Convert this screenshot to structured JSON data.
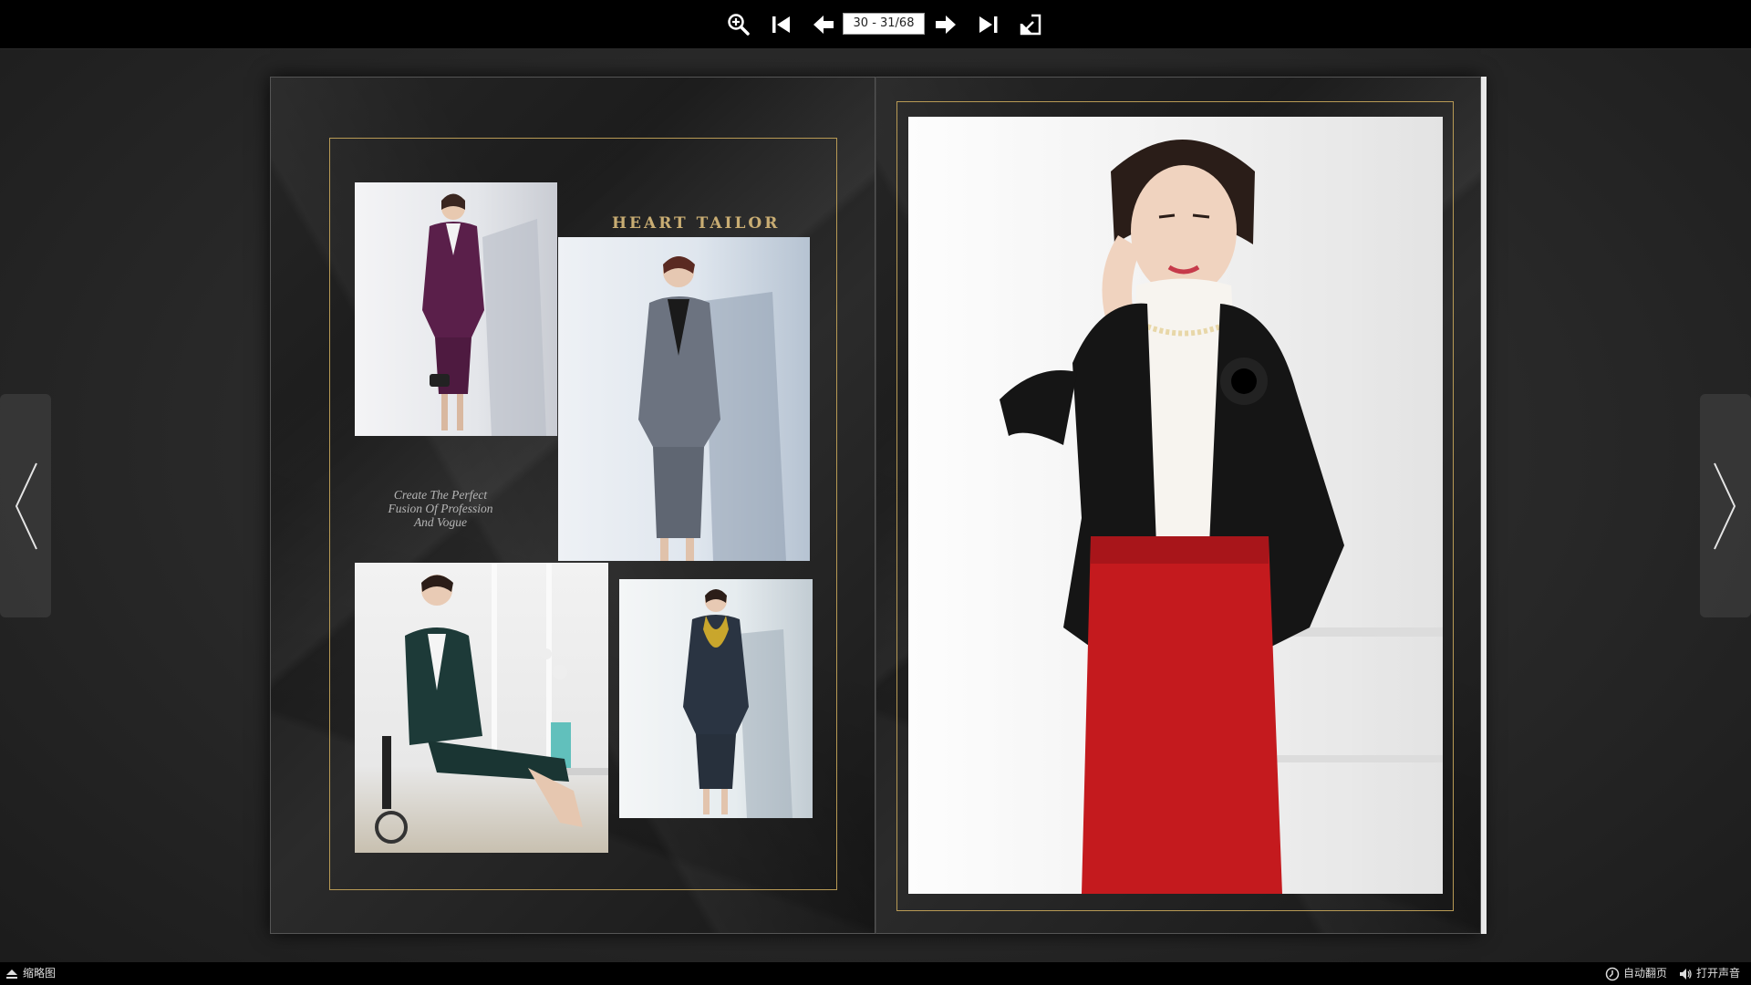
{
  "toolbar": {
    "page_indicator": "30 - 31/68",
    "icons": [
      "zoom-in-icon",
      "first-page-icon",
      "prev-page-icon",
      "next-page-icon",
      "last-page-icon",
      "share-icon"
    ]
  },
  "book": {
    "left_page": {
      "brand": "HEART TAILOR",
      "tagline": [
        "Create The Perfect",
        "Fusion Of Profession",
        "And Vogue"
      ]
    }
  },
  "bottom": {
    "thumbnails_label": "缩略图",
    "auto_flip_label": "自动翻页",
    "sound_label": "打开声音"
  },
  "colors": {
    "gold": "#b89a55",
    "brand_text": "#c9ad73",
    "toolbar_bg": "#000000"
  }
}
